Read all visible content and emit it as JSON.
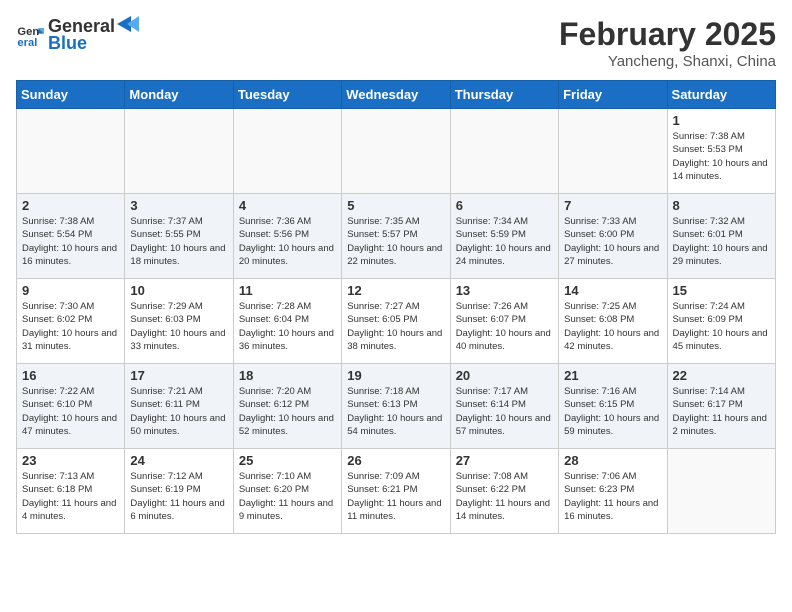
{
  "header": {
    "logo_line1": "General",
    "logo_line2": "Blue",
    "month": "February 2025",
    "location": "Yancheng, Shanxi, China"
  },
  "days_of_week": [
    "Sunday",
    "Monday",
    "Tuesday",
    "Wednesday",
    "Thursday",
    "Friday",
    "Saturday"
  ],
  "weeks": [
    [
      {
        "day": "",
        "info": ""
      },
      {
        "day": "",
        "info": ""
      },
      {
        "day": "",
        "info": ""
      },
      {
        "day": "",
        "info": ""
      },
      {
        "day": "",
        "info": ""
      },
      {
        "day": "",
        "info": ""
      },
      {
        "day": "1",
        "info": "Sunrise: 7:38 AM\nSunset: 5:53 PM\nDaylight: 10 hours and 14 minutes."
      }
    ],
    [
      {
        "day": "2",
        "info": "Sunrise: 7:38 AM\nSunset: 5:54 PM\nDaylight: 10 hours and 16 minutes."
      },
      {
        "day": "3",
        "info": "Sunrise: 7:37 AM\nSunset: 5:55 PM\nDaylight: 10 hours and 18 minutes."
      },
      {
        "day": "4",
        "info": "Sunrise: 7:36 AM\nSunset: 5:56 PM\nDaylight: 10 hours and 20 minutes."
      },
      {
        "day": "5",
        "info": "Sunrise: 7:35 AM\nSunset: 5:57 PM\nDaylight: 10 hours and 22 minutes."
      },
      {
        "day": "6",
        "info": "Sunrise: 7:34 AM\nSunset: 5:59 PM\nDaylight: 10 hours and 24 minutes."
      },
      {
        "day": "7",
        "info": "Sunrise: 7:33 AM\nSunset: 6:00 PM\nDaylight: 10 hours and 27 minutes."
      },
      {
        "day": "8",
        "info": "Sunrise: 7:32 AM\nSunset: 6:01 PM\nDaylight: 10 hours and 29 minutes."
      }
    ],
    [
      {
        "day": "9",
        "info": "Sunrise: 7:30 AM\nSunset: 6:02 PM\nDaylight: 10 hours and 31 minutes."
      },
      {
        "day": "10",
        "info": "Sunrise: 7:29 AM\nSunset: 6:03 PM\nDaylight: 10 hours and 33 minutes."
      },
      {
        "day": "11",
        "info": "Sunrise: 7:28 AM\nSunset: 6:04 PM\nDaylight: 10 hours and 36 minutes."
      },
      {
        "day": "12",
        "info": "Sunrise: 7:27 AM\nSunset: 6:05 PM\nDaylight: 10 hours and 38 minutes."
      },
      {
        "day": "13",
        "info": "Sunrise: 7:26 AM\nSunset: 6:07 PM\nDaylight: 10 hours and 40 minutes."
      },
      {
        "day": "14",
        "info": "Sunrise: 7:25 AM\nSunset: 6:08 PM\nDaylight: 10 hours and 42 minutes."
      },
      {
        "day": "15",
        "info": "Sunrise: 7:24 AM\nSunset: 6:09 PM\nDaylight: 10 hours and 45 minutes."
      }
    ],
    [
      {
        "day": "16",
        "info": "Sunrise: 7:22 AM\nSunset: 6:10 PM\nDaylight: 10 hours and 47 minutes."
      },
      {
        "day": "17",
        "info": "Sunrise: 7:21 AM\nSunset: 6:11 PM\nDaylight: 10 hours and 50 minutes."
      },
      {
        "day": "18",
        "info": "Sunrise: 7:20 AM\nSunset: 6:12 PM\nDaylight: 10 hours and 52 minutes."
      },
      {
        "day": "19",
        "info": "Sunrise: 7:18 AM\nSunset: 6:13 PM\nDaylight: 10 hours and 54 minutes."
      },
      {
        "day": "20",
        "info": "Sunrise: 7:17 AM\nSunset: 6:14 PM\nDaylight: 10 hours and 57 minutes."
      },
      {
        "day": "21",
        "info": "Sunrise: 7:16 AM\nSunset: 6:15 PM\nDaylight: 10 hours and 59 minutes."
      },
      {
        "day": "22",
        "info": "Sunrise: 7:14 AM\nSunset: 6:17 PM\nDaylight: 11 hours and 2 minutes."
      }
    ],
    [
      {
        "day": "23",
        "info": "Sunrise: 7:13 AM\nSunset: 6:18 PM\nDaylight: 11 hours and 4 minutes."
      },
      {
        "day": "24",
        "info": "Sunrise: 7:12 AM\nSunset: 6:19 PM\nDaylight: 11 hours and 6 minutes."
      },
      {
        "day": "25",
        "info": "Sunrise: 7:10 AM\nSunset: 6:20 PM\nDaylight: 11 hours and 9 minutes."
      },
      {
        "day": "26",
        "info": "Sunrise: 7:09 AM\nSunset: 6:21 PM\nDaylight: 11 hours and 11 minutes."
      },
      {
        "day": "27",
        "info": "Sunrise: 7:08 AM\nSunset: 6:22 PM\nDaylight: 11 hours and 14 minutes."
      },
      {
        "day": "28",
        "info": "Sunrise: 7:06 AM\nSunset: 6:23 PM\nDaylight: 11 hours and 16 minutes."
      },
      {
        "day": "",
        "info": ""
      }
    ]
  ]
}
